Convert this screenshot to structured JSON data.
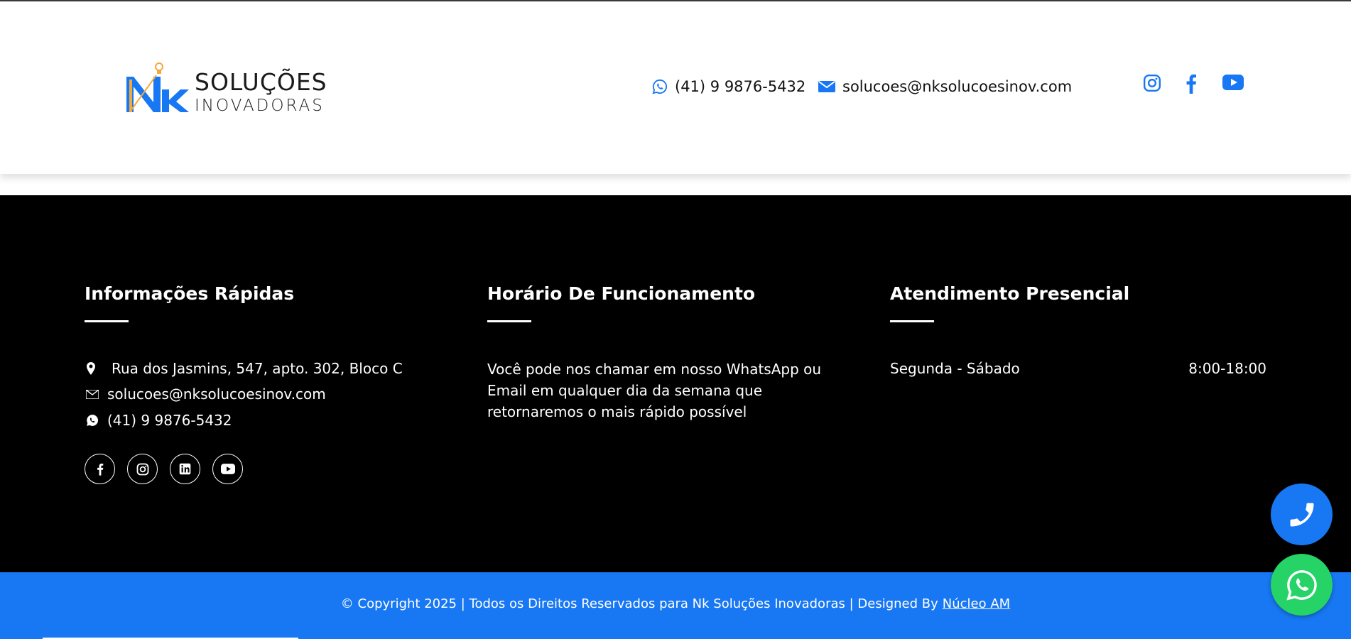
{
  "header": {
    "logo": {
      "line1": "SOLUÇÕES",
      "line2": "INOVADORAS",
      "mark": "NK"
    },
    "phone": "(41) 9 9876-5432",
    "email": "solucoes@nksolucoesinov.com",
    "social_icons": [
      "instagram-icon",
      "facebook-icon",
      "youtube-icon"
    ]
  },
  "footer": {
    "col1": {
      "title": "Informações Rápidas",
      "address": "Rua dos Jasmins, 547, apto. 302, Bloco C",
      "email": "solucoes@nksolucoesinov.com",
      "phone": "(41) 9 9876-5432",
      "social_icons": [
        "facebook-icon",
        "instagram-icon",
        "linkedin-icon",
        "youtube-icon"
      ]
    },
    "col2": {
      "title": "Horário De Funcionamento",
      "text": "Você pode nos chamar em nosso WhatsApp ou Email em qualquer dia da semana que retornaremos o mais rápido possível"
    },
    "col3": {
      "title": "Atendimento Presencial",
      "days": "Segunda - Sábado",
      "hours": "8:00-18:00"
    }
  },
  "copyright": {
    "text": "© Copyright 2025 | Todos os Direitos Reservados para Nk Soluções Inovadoras | Designed By",
    "link": "Núcleo AM"
  },
  "colors": {
    "accent": "#1877f2",
    "whatsapp": "#25d366",
    "footer_bg": "#000000"
  }
}
